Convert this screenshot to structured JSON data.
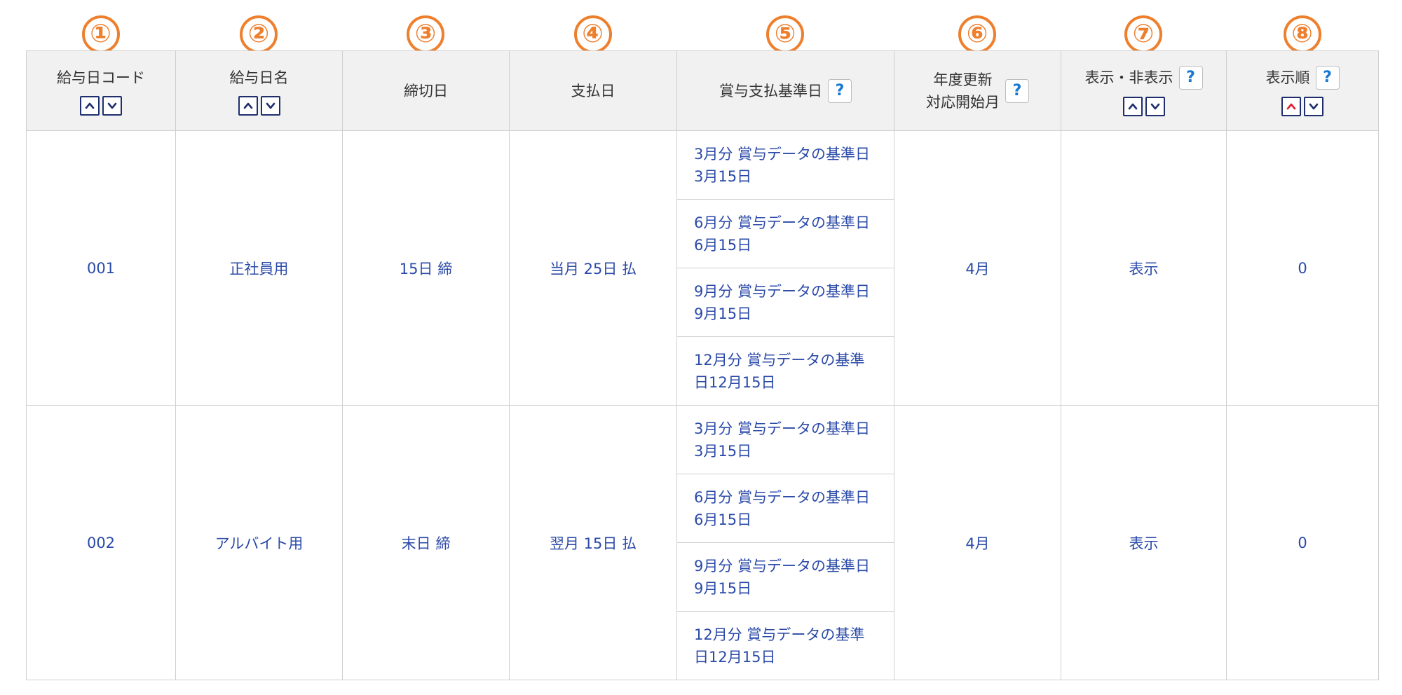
{
  "markers": [
    "①",
    "②",
    "③",
    "④",
    "⑤",
    "⑥",
    "⑦",
    "⑧"
  ],
  "columns": [
    {
      "label": "給与日コード",
      "sortable": true,
      "help": false
    },
    {
      "label": "給与日名",
      "sortable": true,
      "help": false
    },
    {
      "label": "締切日",
      "sortable": false,
      "help": false
    },
    {
      "label": "支払日",
      "sortable": false,
      "help": false
    },
    {
      "label": "賞与支払基準日",
      "sortable": false,
      "help": true
    },
    {
      "label": "年度更新\n対応開始月",
      "sortable": false,
      "help": true
    },
    {
      "label": "表示・非表示",
      "sortable": true,
      "help": true
    },
    {
      "label": "表示順",
      "sortable": true,
      "help": true
    }
  ],
  "help_icon": "question-icon",
  "sort_icons": {
    "up": "chevron-up-icon",
    "down": "chevron-down-icon"
  },
  "colors": {
    "marker": "#ee7f2d",
    "link_text": "#2b4aa8",
    "header_bg": "#f1f1f1",
    "help_glyph": "#1579d3",
    "active_sort": "#e01e2e",
    "sort_border": "#1f2f6d"
  },
  "active_sort": {
    "column": 7,
    "direction": "up"
  },
  "rows": [
    {
      "code": "001",
      "name": "正社員用",
      "closing": "15日 締",
      "payment": "当月 25日 払",
      "bonus_basis": [
        "3月分 賞与データの基準日3月15日",
        "6月分 賞与データの基準日6月15日",
        "9月分 賞与データの基準日9月15日",
        "12月分 賞与データの基準日12月15日"
      ],
      "start_month": "4月",
      "visibility": "表示",
      "order": "0"
    },
    {
      "code": "002",
      "name": "アルバイト用",
      "closing": "末日 締",
      "payment": "翌月 15日 払",
      "bonus_basis": [
        "3月分 賞与データの基準日3月15日",
        "6月分 賞与データの基準日6月15日",
        "9月分 賞与データの基準日9月15日",
        "12月分 賞与データの基準日12月15日"
      ],
      "start_month": "4月",
      "visibility": "表示",
      "order": "0"
    }
  ]
}
